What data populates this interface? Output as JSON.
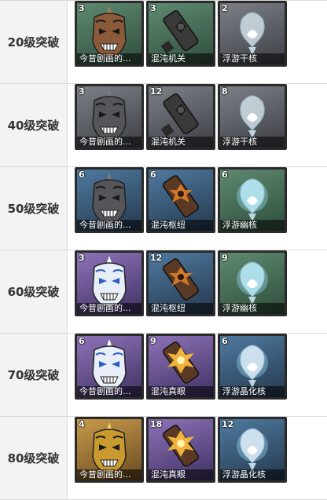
{
  "rows": [
    {
      "label": "20级突破",
      "items": [
        {
          "count": "3",
          "name": "今昔剧画的...",
          "icon": "oni-mask-bronze-icon",
          "bg": "green"
        },
        {
          "count": "3",
          "name": "混沌机关",
          "icon": "chaos-device-icon",
          "bg": "green"
        },
        {
          "count": "2",
          "name": "浮游干核",
          "icon": "floating-core-dry-icon",
          "bg": "gray"
        }
      ]
    },
    {
      "label": "40级突破",
      "items": [
        {
          "count": "3",
          "name": "今昔剧画的...",
          "icon": "oni-mask-silver-icon",
          "bg": "gray"
        },
        {
          "count": "12",
          "name": "混沌机关",
          "icon": "chaos-device-icon",
          "bg": "gray"
        },
        {
          "count": "8",
          "name": "浮游干核",
          "icon": "floating-core-dry-icon",
          "bg": "gray"
        }
      ]
    },
    {
      "label": "50级突破",
      "items": [
        {
          "count": "6",
          "name": "今昔剧画的...",
          "icon": "oni-mask-silver-icon",
          "bg": "blue"
        },
        {
          "count": "6",
          "name": "混沌枢纽",
          "icon": "chaos-circuit-icon",
          "bg": "blue"
        },
        {
          "count": "6",
          "name": "浮游幽核",
          "icon": "floating-core-glow-icon",
          "bg": "green"
        }
      ]
    },
    {
      "label": "60级突破",
      "items": [
        {
          "count": "3",
          "name": "今昔剧画的...",
          "icon": "oni-mask-blue-icon",
          "bg": "purple"
        },
        {
          "count": "12",
          "name": "混沌枢纽",
          "icon": "chaos-circuit-icon",
          "bg": "blue"
        },
        {
          "count": "9",
          "name": "浮游幽核",
          "icon": "floating-core-glow-icon",
          "bg": "green"
        }
      ]
    },
    {
      "label": "70级突破",
      "items": [
        {
          "count": "6",
          "name": "今昔剧画的...",
          "icon": "oni-mask-blue-icon",
          "bg": "purple"
        },
        {
          "count": "9",
          "name": "混沌真眼",
          "icon": "chaos-eye-icon",
          "bg": "purple"
        },
        {
          "count": "6",
          "name": "浮游晶化核",
          "icon": "floating-core-crystal-icon",
          "bg": "blue"
        }
      ]
    },
    {
      "label": "80级突破",
      "items": [
        {
          "count": "4",
          "name": "今昔剧画的...",
          "icon": "oni-mask-gold-icon",
          "bg": "gold"
        },
        {
          "count": "18",
          "name": "混沌真眼",
          "icon": "chaos-eye-icon",
          "bg": "purple"
        },
        {
          "count": "12",
          "name": "浮游晶化核",
          "icon": "floating-core-crystal-icon",
          "bg": "blue"
        }
      ]
    }
  ],
  "colors": {
    "green": [
      "#5f8a70",
      "#2f4d3d"
    ],
    "gray": [
      "#7d8087",
      "#3d3f45"
    ],
    "blue": [
      "#4f7aa0",
      "#25384d"
    ],
    "purple": [
      "#8e73b8",
      "#3f3163"
    ],
    "gold": [
      "#c79a4a",
      "#6a4a22"
    ]
  }
}
